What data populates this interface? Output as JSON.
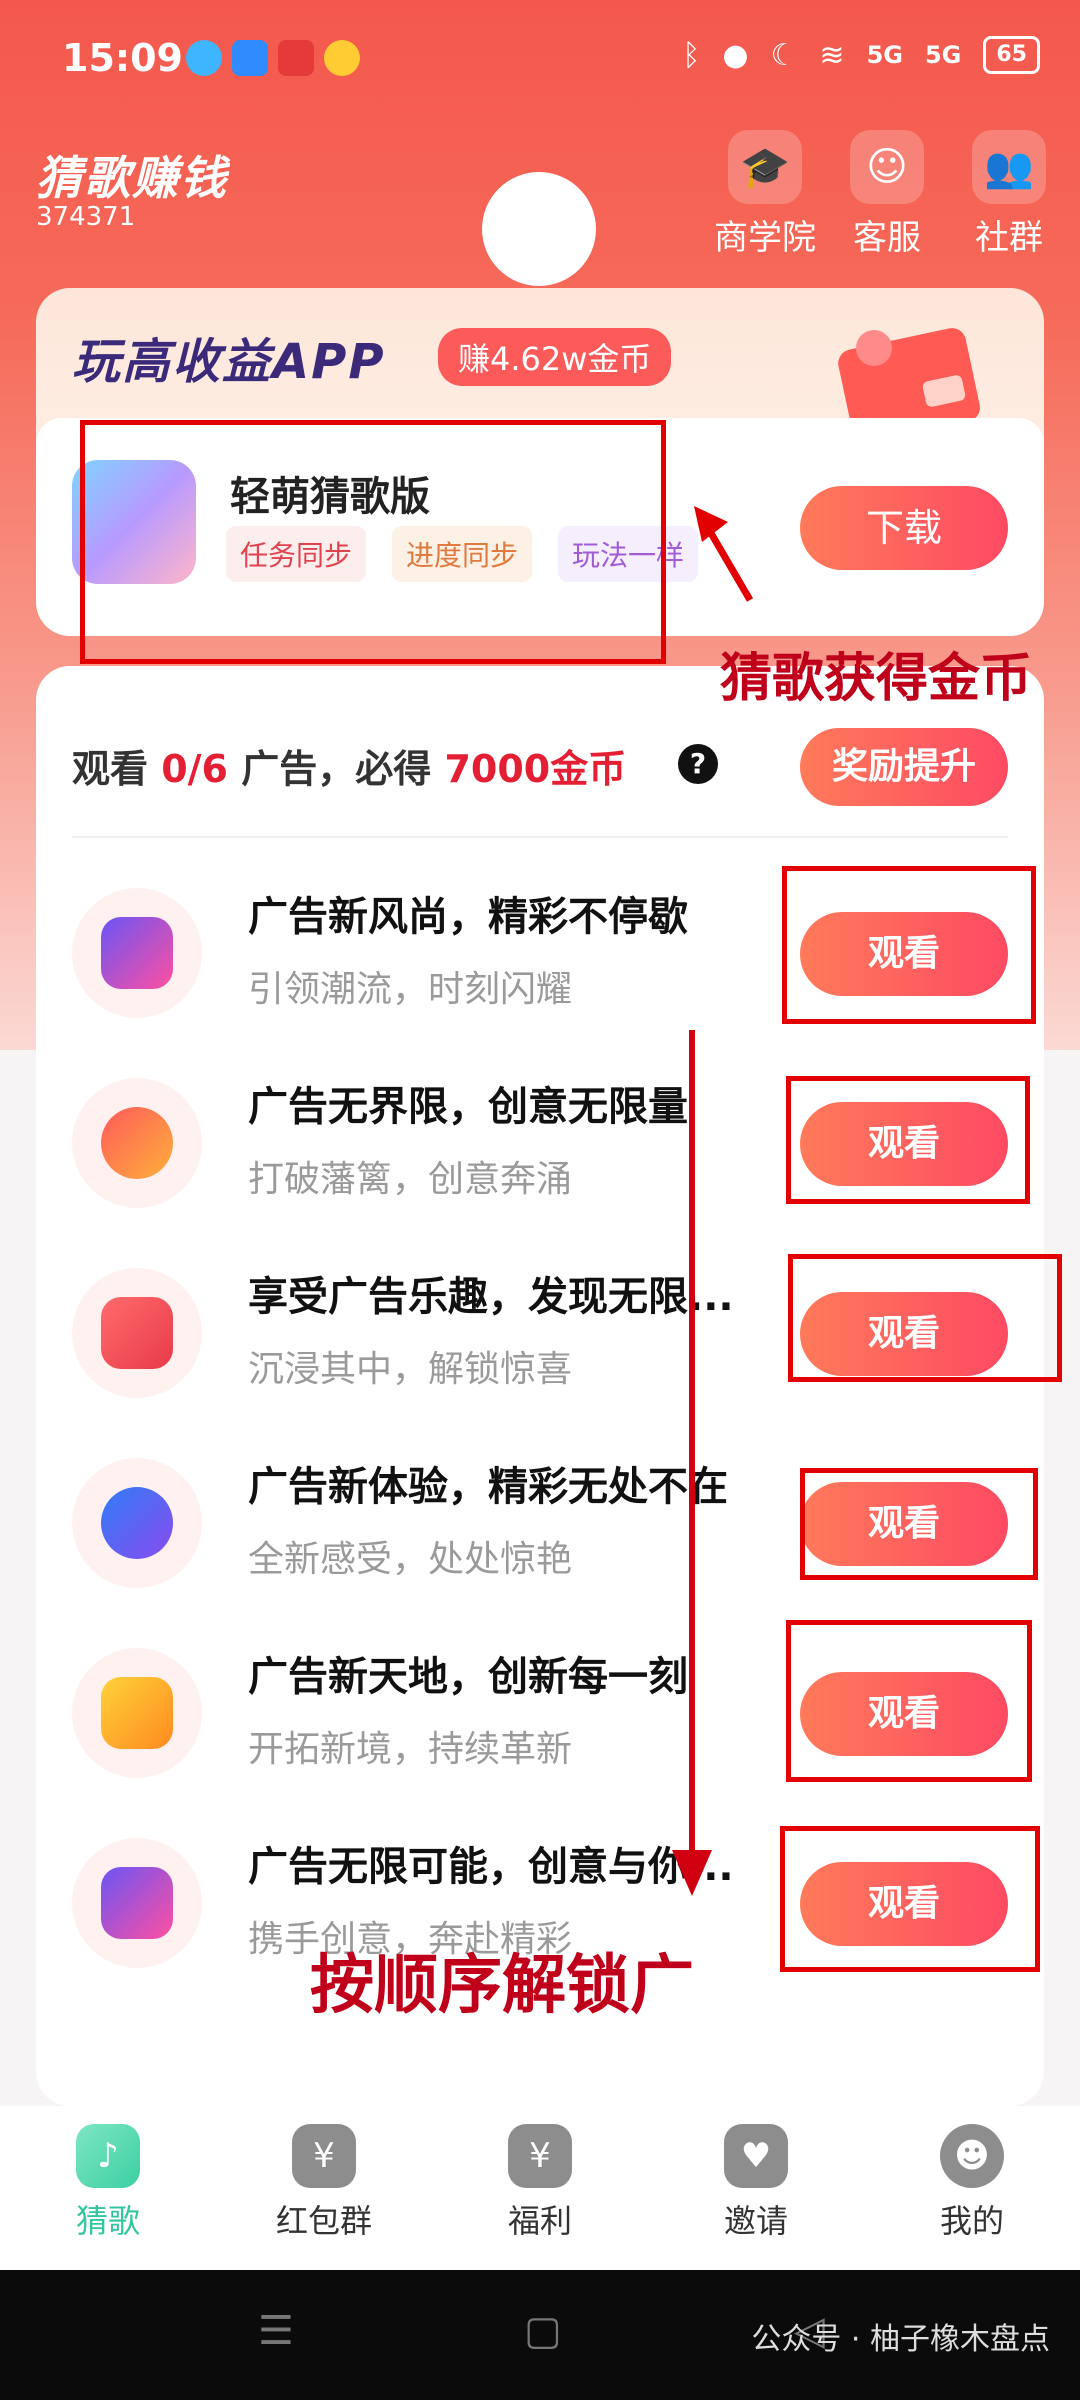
{
  "status_bar": {
    "time": "15:09",
    "battery": "65",
    "network": "5G"
  },
  "header": {
    "title": "猜歌赚钱",
    "id": "374371",
    "buttons": [
      {
        "label": "商学院",
        "icon": "academy-icon"
      },
      {
        "label": "客服",
        "icon": "support-icon"
      },
      {
        "label": "社群",
        "icon": "community-icon"
      }
    ]
  },
  "promo": {
    "title": "玩高收益APP",
    "badge": "赚4.62w金币",
    "app_name": "轻萌猜歌版",
    "tags": [
      "任务同步",
      "进度同步",
      "玩法一样"
    ],
    "download_label": "下载"
  },
  "annotations": {
    "promo_note": "猜歌获得金币",
    "order_note": "按顺序解锁广"
  },
  "tasks": {
    "head_prefix": "观看 ",
    "head_progress": "0/6",
    "head_mid": " 广告，必得 ",
    "head_reward": "7000金币",
    "boost_label": "奖励提升",
    "items": [
      {
        "title": "广告新风尚，精彩不停歇",
        "subtitle": "引领潮流，时刻闪耀",
        "button": "观看",
        "color": "#6a55f5"
      },
      {
        "title": "广告无界限，创意无限量",
        "subtitle": "打破藩篱，创意奔涌",
        "button": "观看",
        "color": "#ff8a3d"
      },
      {
        "title": "享受广告乐趣，发现无限...",
        "subtitle": "沉浸其中，解锁惊喜",
        "button": "观看",
        "color": "#f2474a"
      },
      {
        "title": "广告新体验，精彩无处不在",
        "subtitle": "全新感受，处处惊艳",
        "button": "观看",
        "color": "#3a6ff0"
      },
      {
        "title": "广告新天地，创新每一刻",
        "subtitle": "开拓新境，持续革新",
        "button": "观看",
        "color": "#ffb21f"
      },
      {
        "title": "广告无限可能，创意与你...",
        "subtitle": "携手创意，奔赴精彩",
        "button": "观看",
        "color": "#6a55f5"
      }
    ]
  },
  "nav": [
    {
      "label": "猜歌",
      "icon": "music-note-icon",
      "active": true
    },
    {
      "label": "红包群",
      "icon": "red-packet-icon",
      "active": false
    },
    {
      "label": "福利",
      "icon": "money-bag-icon",
      "active": false
    },
    {
      "label": "邀请",
      "icon": "invite-icon",
      "active": false
    },
    {
      "label": "我的",
      "icon": "profile-icon",
      "active": false
    }
  ],
  "watermark_text": "公众号 · 柚子橡木盘点"
}
